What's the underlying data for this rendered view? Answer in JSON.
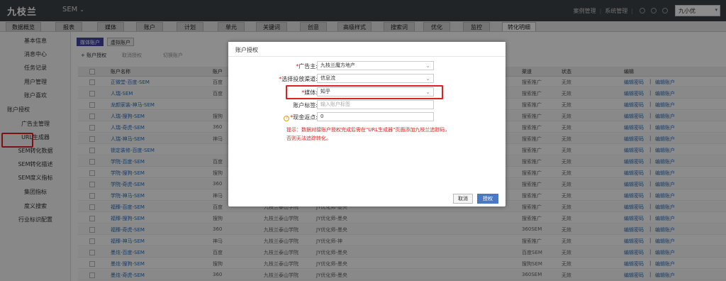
{
  "header": {
    "logo": "九枝兰",
    "product": "SEM",
    "links": [
      "案例管理",
      "系统管理"
    ],
    "user": "九小优"
  },
  "nav": {
    "tabs": [
      "数据概览",
      "报表",
      "媒体",
      "账户",
      "计划",
      "单元",
      "关键词",
      "创意",
      "高级样式",
      "搜索词",
      "优化",
      "监控",
      "转化明细"
    ]
  },
  "sidebar": {
    "items": [
      "基本信息",
      "消息中心",
      "任务记录",
      "用户管理",
      "账户喜欢",
      "账户授权",
      "广告主管理",
      "URL生成器",
      "SEM转化数据",
      "SEM转化描述",
      "SEM度义指标",
      "集团指标",
      "度义搜索",
      "行业标识配置"
    ]
  },
  "content": {
    "subtabs": [
      "媒体账户",
      "虚拟账户"
    ],
    "toolbar": [
      "+ 账户授权",
      "取消授权",
      "切换账户"
    ],
    "columns": [
      "账户名称",
      "账户",
      "渠道",
      "状态",
      "编辑"
    ],
    "rows": [
      {
        "name": "正微堂-百度-SEM",
        "media": "百度",
        "company": "",
        "agent": "",
        "channel": "搜索推广",
        "status": "无效"
      },
      {
        "name": "人瑞-SEM",
        "media": "百度",
        "company": "",
        "agent": "",
        "channel": "搜索推广",
        "status": "无效"
      },
      {
        "name": "龙颜家装-神马-SEM",
        "media": "",
        "company": "",
        "agent": "",
        "channel": "搜索推广",
        "status": "无效"
      },
      {
        "name": "人瑞-搜狗-SEM",
        "media": "搜狗",
        "company": "",
        "agent": "",
        "channel": "搜索推广",
        "status": "无效"
      },
      {
        "name": "人瑞-奇虎-SEM",
        "media": "360",
        "company": "",
        "agent": "",
        "channel": "搜索推广",
        "status": "无效"
      },
      {
        "name": "人瑞-神马-SEM",
        "media": "神马",
        "company": "",
        "agent": "",
        "channel": "搜索推广",
        "status": "无效"
      },
      {
        "name": "锁定装修-百度-SEM",
        "media": "",
        "company": "",
        "agent": "",
        "channel": "搜索推广",
        "status": "无效"
      },
      {
        "name": "学院-百度-SEM",
        "media": "百度",
        "company": "",
        "agent": "",
        "channel": "搜索推广",
        "status": "无效"
      },
      {
        "name": "学院-搜狗-SEM",
        "media": "搜狗",
        "company": "",
        "agent": "",
        "channel": "搜索推广",
        "status": "无效"
      },
      {
        "name": "学院-奇虎-SEM",
        "media": "360",
        "company": "",
        "agent": "",
        "channel": "搜索推广",
        "status": "无效"
      },
      {
        "name": "学院-神马-SEM",
        "media": "神马",
        "company": "",
        "agent": "",
        "channel": "搜索推广",
        "status": "无效"
      },
      {
        "name": "福臻-百度-SEM",
        "media": "百度",
        "company": "九枝兰泰山学院",
        "agent": "JY优化师-墨央",
        "channel": "搜索推广",
        "status": "无效"
      },
      {
        "name": "福臻-搜狗-SEM",
        "media": "搜狗",
        "company": "九枝兰泰山学院",
        "agent": "JY优化师-墨央",
        "channel": "搜索推广",
        "status": "无效"
      },
      {
        "name": "福臻-奇虎-SEM",
        "media": "360",
        "company": "九枝兰泰山学院",
        "agent": "JY优化师-墨央",
        "channel": "360SEM",
        "status": "无效"
      },
      {
        "name": "福臻-神马-SEM",
        "media": "神马",
        "company": "九枝兰泰山学院",
        "agent": "JY优化师-神",
        "channel": "搜索推广",
        "status": "无效"
      },
      {
        "name": "墨炫-百度-SEM",
        "media": "百度",
        "company": "九枝兰泰山学院",
        "agent": "JY优化师-墨央",
        "channel": "百度SEM",
        "status": "无效"
      },
      {
        "name": "墨炫-搜狗-SEM",
        "media": "搜狗",
        "company": "九枝兰泰山学院",
        "agent": "JY优化师-墨央",
        "channel": "搜狗SEM",
        "status": "无效"
      },
      {
        "name": "墨炫-奇虎-SEM",
        "media": "360",
        "company": "九枝兰泰山学院",
        "agent": "JY优化师-墨央",
        "channel": "360SEM",
        "status": "无效"
      }
    ],
    "edit_links": [
      "编辑密码",
      "编辑账户"
    ]
  },
  "modal": {
    "title": "账户授权",
    "fields": [
      {
        "label": "广告主:",
        "required": true,
        "value": "九枝兰魔方地产",
        "placeholder": "",
        "dropdown": true
      },
      {
        "label": "选择投放渠道:",
        "required": true,
        "value": "信息流",
        "placeholder": "",
        "dropdown": true
      },
      {
        "label": "媒体:",
        "required": true,
        "value": "知乎",
        "placeholder": "",
        "dropdown": true
      },
      {
        "label": "账户标签:",
        "required": false,
        "value": "",
        "placeholder": "输入账户标签",
        "dropdown": false
      },
      {
        "label": "现金返点:",
        "required": true,
        "value": "0",
        "placeholder": "",
        "dropdown": false
      }
    ],
    "hint": "提示：数据对接账户授权完成后需在\"URL生成器\"页面添加九枝兰追踪码，否则无法追踪转化。",
    "cancel": "取消",
    "confirm": "授权"
  },
  "colors": {
    "highlight": "#e02020",
    "primary": "#4a78c2",
    "header": "#3d4247"
  }
}
